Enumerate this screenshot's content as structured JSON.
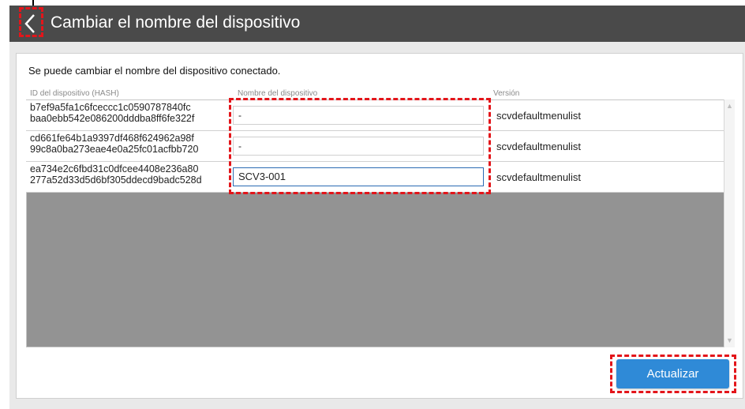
{
  "window": {
    "title": "Cambiar el nombre del dispositivo",
    "back_icon": "chevron-left-icon"
  },
  "main": {
    "description": "Se puede cambiar el nombre del dispositivo conectado.",
    "columns": {
      "id": "ID del dispositivo (HASH)",
      "name": "Nombre del dispositivo",
      "version": "Versión"
    },
    "rows": [
      {
        "hash_line1": "b7ef9a5fa1c6fceccc1c0590787840fc",
        "hash_line2": "baa0ebb542e086200dddba8ff6fe322f",
        "name": "-",
        "version": "scvdefaultmenulist"
      },
      {
        "hash_line1": "cd661fe64b1a9397df468f624962a98f",
        "hash_line2": "99c8a0ba273eae4e0a25fc01acfbb720",
        "name": "-",
        "version": "scvdefaultmenulist"
      },
      {
        "hash_line1": "ea734e2c6fbd31c0dfcee4408e236a80",
        "hash_line2": "277a52d33d5d6bf305ddecd9badc528d",
        "name": "SCV3-001",
        "version": "scvdefaultmenulist"
      }
    ]
  },
  "footer": {
    "update_label": "Actualizar"
  },
  "colors": {
    "header_bg": "#4a4a4a",
    "accent": "#2f8ad7",
    "callout": "#e3151a"
  }
}
